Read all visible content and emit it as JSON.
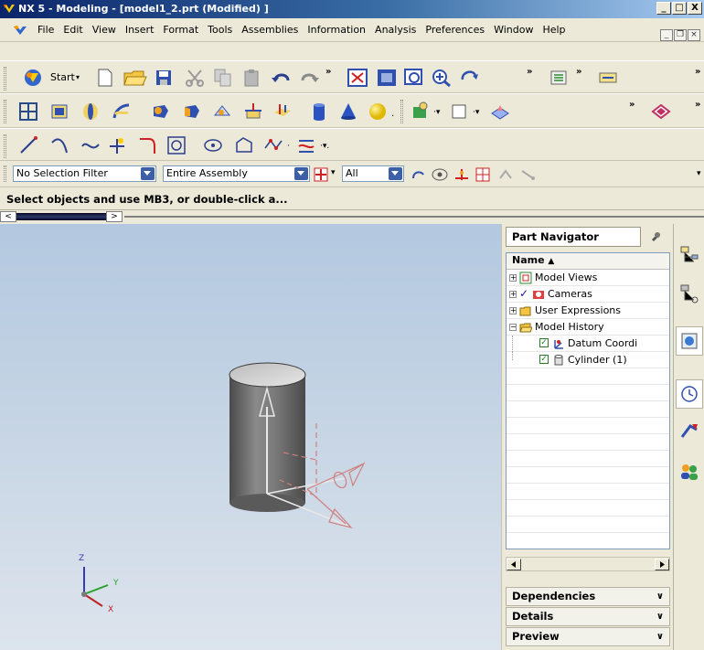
{
  "window": {
    "title": "NX 5 - Modeling - [model1_2.prt (Modified) ]",
    "min_label": "_",
    "max_label": "□",
    "close_label": "X"
  },
  "menu": {
    "items": [
      "File",
      "Edit",
      "View",
      "Insert",
      "Format",
      "Tools",
      "Assemblies",
      "Information",
      "Analysis",
      "Preferences",
      "Window",
      "Help"
    ]
  },
  "toolbar": {
    "start_label": "Start"
  },
  "filterbar": {
    "selection_filter": "No Selection Filter",
    "assembly_scope": "Entire Assembly",
    "type_filter": "All"
  },
  "status": {
    "prompt": "Select objects and use MB3, or double-click a..."
  },
  "viewport": {
    "axes": {
      "z": "Z",
      "y": "Y",
      "x": "X"
    }
  },
  "navigator": {
    "title": "Part Navigator",
    "column_header": "Name",
    "items": [
      {
        "label": "Model Views",
        "icon": "model-views-icon"
      },
      {
        "label": "Cameras",
        "icon": "cameras-icon"
      },
      {
        "label": "User Expressions",
        "icon": "folder-icon"
      },
      {
        "label": "Model History",
        "icon": "folder-open-icon"
      },
      {
        "label": "Datum Coordi",
        "icon": "datum-csys-icon"
      },
      {
        "label": "Cylinder (1)",
        "icon": "cylinder-icon"
      }
    ],
    "sections": [
      "Dependencies",
      "Details",
      "Preview"
    ]
  },
  "colors": {
    "titlebar_start": "#0a246a",
    "viewport_top": "#b3c8e0",
    "cylinder": "#6e6e6e",
    "datum_dashed": "#d08080"
  }
}
